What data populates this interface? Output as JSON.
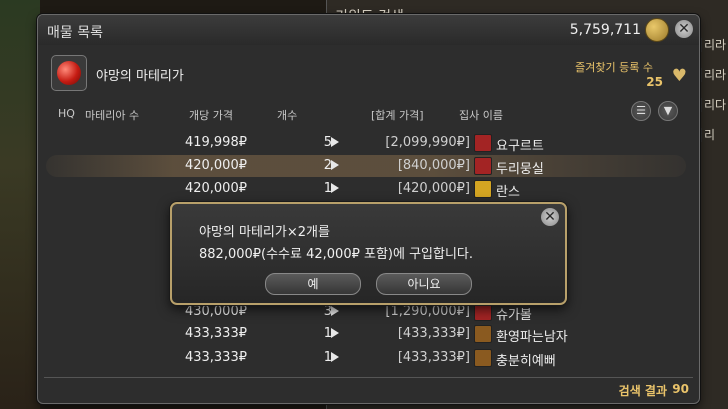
{
  "background": {
    "behind_window_title": "키워드 검색",
    "behind_items": [
      "리라",
      "리라",
      "리다",
      "리"
    ]
  },
  "window": {
    "title": "매물 목록",
    "gil_amount": "5,759,711",
    "item": {
      "name": "야망의 마테리가",
      "favorite_label": "즐겨찾기 등록 수",
      "favorite_count": "25"
    },
    "columns": {
      "hq": "HQ",
      "materia": "마테리아 수",
      "unit_price": "개당 가격",
      "quantity": "개수",
      "total": "[합계 가격]",
      "retainer": "집사 이름"
    },
    "rows": [
      {
        "price": "419,998₽",
        "qty": "5",
        "total": "[2,099,990₽]",
        "retainer": "요구르트",
        "icon": "red"
      },
      {
        "price": "420,000₽",
        "qty": "2",
        "total": "[840,000₽]",
        "retainer": "두리뭉실",
        "icon": "red"
      },
      {
        "price": "420,000₽",
        "qty": "1",
        "total": "[420,000₽]",
        "retainer": "란스",
        "icon": "gold"
      },
      {
        "price": "430,000₽",
        "qty": "3",
        "total": "[1,290,000₽]",
        "retainer": "슈가볼",
        "icon": "red"
      },
      {
        "price": "433,333₽",
        "qty": "1",
        "total": "[433,333₽]",
        "retainer": "환영파는남자",
        "icon": "brown"
      },
      {
        "price": "433,333₽",
        "qty": "1",
        "total": "[433,333₽]",
        "retainer": "충분히예뻐",
        "icon": "brown"
      }
    ],
    "results_label": "검색 결과",
    "results_count": "90"
  },
  "dialog": {
    "line1": "야망의 마테리가×2개를",
    "line2": "882,000₽(수수료 42,000₽ 포함)에 구입합니다.",
    "yes_label": "예",
    "no_label": "아니요"
  },
  "colors": {
    "accent_gold": "#e9c36a",
    "dialog_border": "#b8a06a",
    "selected_row": "#b48c5a"
  }
}
